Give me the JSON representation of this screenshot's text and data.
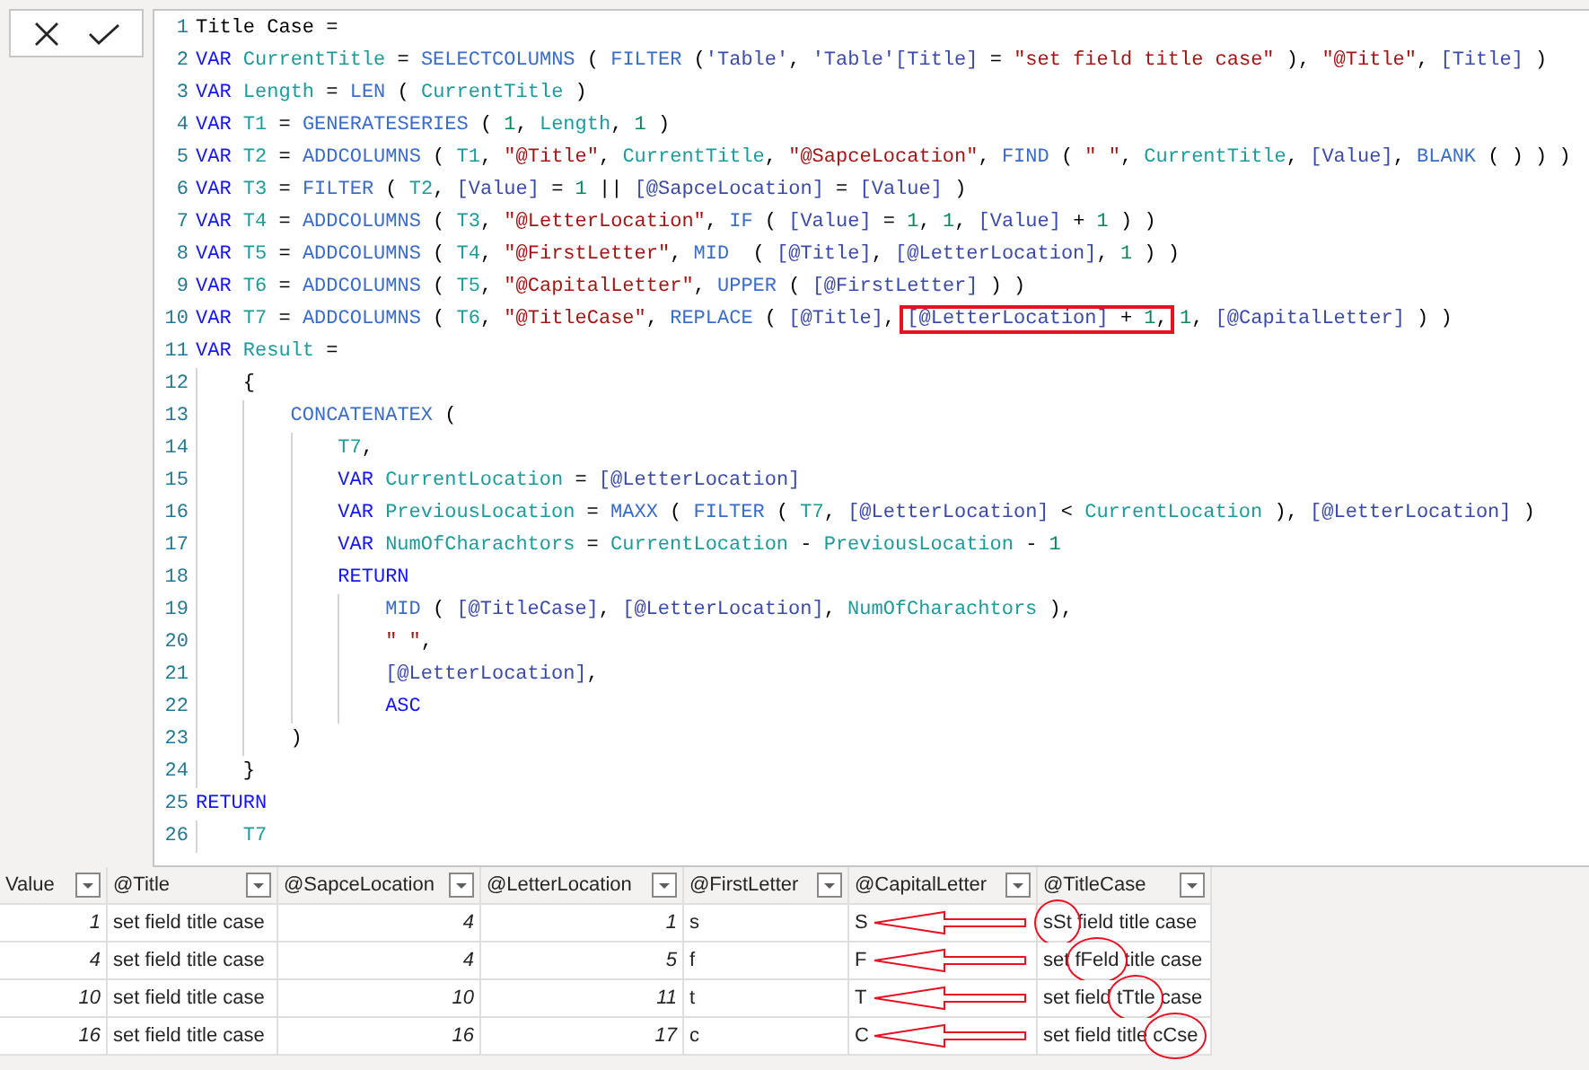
{
  "formula_bar": {
    "buttons": [
      {
        "kind": "cancel"
      },
      {
        "kind": "commit"
      }
    ]
  },
  "editor": {
    "lines": [
      {
        "number": "1",
        "tokens": [
          {
            "kind": "plain",
            "text": "Title Case ="
          }
        ]
      },
      {
        "number": "2",
        "tokens": [
          {
            "kind": "keyword",
            "text": "VAR"
          },
          {
            "kind": "variable",
            "text": " CurrentTitle"
          },
          {
            "kind": "plain",
            "text": " = "
          },
          {
            "kind": "function",
            "text": "SELECTCOLUMNS"
          },
          {
            "kind": "plain",
            "text": " ( "
          },
          {
            "kind": "function",
            "text": "FILTER"
          },
          {
            "kind": "plain",
            "text": " ("
          },
          {
            "kind": "column",
            "text": "'Table'"
          },
          {
            "kind": "plain",
            "text": ", "
          },
          {
            "kind": "column",
            "text": "'Table'[Title]"
          },
          {
            "kind": "plain",
            "text": " = "
          },
          {
            "kind": "string",
            "text": "\"set field title case\""
          },
          {
            "kind": "plain",
            "text": " ), "
          },
          {
            "kind": "string",
            "text": "\"@Title\""
          },
          {
            "kind": "plain",
            "text": ", "
          },
          {
            "kind": "column",
            "text": "[Title]"
          },
          {
            "kind": "plain",
            "text": " )"
          }
        ]
      },
      {
        "number": "3",
        "tokens": [
          {
            "kind": "keyword",
            "text": "VAR"
          },
          {
            "kind": "variable",
            "text": " Length"
          },
          {
            "kind": "plain",
            "text": " = "
          },
          {
            "kind": "function",
            "text": "LEN"
          },
          {
            "kind": "plain",
            "text": " ( "
          },
          {
            "kind": "variable",
            "text": "CurrentTitle"
          },
          {
            "kind": "plain",
            "text": " )"
          }
        ]
      },
      {
        "number": "4",
        "tokens": [
          {
            "kind": "keyword",
            "text": "VAR"
          },
          {
            "kind": "variable",
            "text": " T1"
          },
          {
            "kind": "plain",
            "text": " = "
          },
          {
            "kind": "function",
            "text": "GENERATESERIES"
          },
          {
            "kind": "plain",
            "text": " ( "
          },
          {
            "kind": "number",
            "text": "1"
          },
          {
            "kind": "plain",
            "text": ", "
          },
          {
            "kind": "variable",
            "text": "Length"
          },
          {
            "kind": "plain",
            "text": ", "
          },
          {
            "kind": "number",
            "text": "1"
          },
          {
            "kind": "plain",
            "text": " )"
          }
        ]
      },
      {
        "number": "5",
        "tokens": [
          {
            "kind": "keyword",
            "text": "VAR"
          },
          {
            "kind": "variable",
            "text": " T2"
          },
          {
            "kind": "plain",
            "text": " = "
          },
          {
            "kind": "function",
            "text": "ADDCOLUMNS"
          },
          {
            "kind": "plain",
            "text": " ( "
          },
          {
            "kind": "variable",
            "text": "T1"
          },
          {
            "kind": "plain",
            "text": ", "
          },
          {
            "kind": "string",
            "text": "\"@Title\""
          },
          {
            "kind": "plain",
            "text": ", "
          },
          {
            "kind": "variable",
            "text": "CurrentTitle"
          },
          {
            "kind": "plain",
            "text": ", "
          },
          {
            "kind": "string",
            "text": "\"@SapceLocation\""
          },
          {
            "kind": "plain",
            "text": ", "
          },
          {
            "kind": "function",
            "text": "FIND"
          },
          {
            "kind": "plain",
            "text": " ( "
          },
          {
            "kind": "string",
            "text": "\" \""
          },
          {
            "kind": "plain",
            "text": ", "
          },
          {
            "kind": "variable",
            "text": "CurrentTitle"
          },
          {
            "kind": "plain",
            "text": ", "
          },
          {
            "kind": "column",
            "text": "[Value]"
          },
          {
            "kind": "plain",
            "text": ", "
          },
          {
            "kind": "function",
            "text": "BLANK"
          },
          {
            "kind": "plain",
            "text": " ( ) ) )"
          }
        ]
      },
      {
        "number": "6",
        "tokens": [
          {
            "kind": "keyword",
            "text": "VAR"
          },
          {
            "kind": "variable",
            "text": " T3"
          },
          {
            "kind": "plain",
            "text": " = "
          },
          {
            "kind": "function",
            "text": "FILTER"
          },
          {
            "kind": "plain",
            "text": " ( "
          },
          {
            "kind": "variable",
            "text": "T2"
          },
          {
            "kind": "plain",
            "text": ", "
          },
          {
            "kind": "column",
            "text": "[Value]"
          },
          {
            "kind": "plain",
            "text": " = "
          },
          {
            "kind": "number",
            "text": "1"
          },
          {
            "kind": "plain",
            "text": " || "
          },
          {
            "kind": "column",
            "text": "[@SapceLocation]"
          },
          {
            "kind": "plain",
            "text": " = "
          },
          {
            "kind": "column",
            "text": "[Value]"
          },
          {
            "kind": "plain",
            "text": " )"
          }
        ]
      },
      {
        "number": "7",
        "tokens": [
          {
            "kind": "keyword",
            "text": "VAR"
          },
          {
            "kind": "variable",
            "text": " T4"
          },
          {
            "kind": "plain",
            "text": " = "
          },
          {
            "kind": "function",
            "text": "ADDCOLUMNS"
          },
          {
            "kind": "plain",
            "text": " ( "
          },
          {
            "kind": "variable",
            "text": "T3"
          },
          {
            "kind": "plain",
            "text": ", "
          },
          {
            "kind": "string",
            "text": "\"@LetterLocation\""
          },
          {
            "kind": "plain",
            "text": ", "
          },
          {
            "kind": "function",
            "text": "IF"
          },
          {
            "kind": "plain",
            "text": " ( "
          },
          {
            "kind": "column",
            "text": "[Value]"
          },
          {
            "kind": "plain",
            "text": " = "
          },
          {
            "kind": "number",
            "text": "1"
          },
          {
            "kind": "plain",
            "text": ", "
          },
          {
            "kind": "number",
            "text": "1"
          },
          {
            "kind": "plain",
            "text": ", "
          },
          {
            "kind": "column",
            "text": "[Value]"
          },
          {
            "kind": "plain",
            "text": " + "
          },
          {
            "kind": "number",
            "text": "1"
          },
          {
            "kind": "plain",
            "text": " ) )"
          }
        ]
      },
      {
        "number": "8",
        "tokens": [
          {
            "kind": "keyword",
            "text": "VAR"
          },
          {
            "kind": "variable",
            "text": " T5"
          },
          {
            "kind": "plain",
            "text": " = "
          },
          {
            "kind": "function",
            "text": "ADDCOLUMNS"
          },
          {
            "kind": "plain",
            "text": " ( "
          },
          {
            "kind": "variable",
            "text": "T4"
          },
          {
            "kind": "plain",
            "text": ", "
          },
          {
            "kind": "string",
            "text": "\"@FirstLetter\""
          },
          {
            "kind": "plain",
            "text": ", "
          },
          {
            "kind": "function",
            "text": "MID"
          },
          {
            "kind": "plain",
            "text": "  ( "
          },
          {
            "kind": "column",
            "text": "[@Title]"
          },
          {
            "kind": "plain",
            "text": ", "
          },
          {
            "kind": "column",
            "text": "[@LetterLocation]"
          },
          {
            "kind": "plain",
            "text": ", "
          },
          {
            "kind": "number",
            "text": "1"
          },
          {
            "kind": "plain",
            "text": " ) )"
          }
        ]
      },
      {
        "number": "9",
        "tokens": [
          {
            "kind": "keyword",
            "text": "VAR"
          },
          {
            "kind": "variable",
            "text": " T6"
          },
          {
            "kind": "plain",
            "text": " = "
          },
          {
            "kind": "function",
            "text": "ADDCOLUMNS"
          },
          {
            "kind": "plain",
            "text": " ( "
          },
          {
            "kind": "variable",
            "text": "T5"
          },
          {
            "kind": "plain",
            "text": ", "
          },
          {
            "kind": "string",
            "text": "\"@CapitalLetter\""
          },
          {
            "kind": "plain",
            "text": ", "
          },
          {
            "kind": "function",
            "text": "UPPER"
          },
          {
            "kind": "plain",
            "text": " ( "
          },
          {
            "kind": "column",
            "text": "[@FirstLetter]"
          },
          {
            "kind": "plain",
            "text": " ) )"
          }
        ]
      },
      {
        "number": "10",
        "tokens": [
          {
            "kind": "keyword",
            "text": "VAR"
          },
          {
            "kind": "variable",
            "text": " T7"
          },
          {
            "kind": "plain",
            "text": " = "
          },
          {
            "kind": "function",
            "text": "ADDCOLUMNS"
          },
          {
            "kind": "plain",
            "text": " ( "
          },
          {
            "kind": "variable",
            "text": "T6"
          },
          {
            "kind": "plain",
            "text": ", "
          },
          {
            "kind": "string",
            "text": "\"@TitleCase\""
          },
          {
            "kind": "plain",
            "text": ", "
          },
          {
            "kind": "function",
            "text": "REPLACE"
          },
          {
            "kind": "plain",
            "text": " ( "
          },
          {
            "kind": "column",
            "text": "[@Title]"
          },
          {
            "kind": "plain",
            "text": ", "
          },
          {
            "kind": "column",
            "text": "[@LetterLocation]",
            "boxed": true
          },
          {
            "kind": "plain",
            "text": " + ",
            "boxed": true
          },
          {
            "kind": "number",
            "text": "1",
            "boxed": true
          },
          {
            "kind": "plain",
            "text": ",",
            "boxed": true
          },
          {
            "kind": "number",
            "text": " 1"
          },
          {
            "kind": "plain",
            "text": ", "
          },
          {
            "kind": "column",
            "text": "[@CapitalLetter]"
          },
          {
            "kind": "plain",
            "text": " ) )"
          }
        ]
      },
      {
        "number": "11",
        "tokens": [
          {
            "kind": "keyword",
            "text": "VAR"
          },
          {
            "kind": "variable",
            "text": " Result"
          },
          {
            "kind": "plain",
            "text": " ="
          }
        ],
        "children": [
          {
            "number": "12",
            "tokens": [
              {
                "kind": "plain",
                "text": "{"
              }
            ],
            "children": [
              {
                "number": "13",
                "tokens": [
                  {
                    "kind": "function",
                    "text": "CONCATENATEX"
                  },
                  {
                    "kind": "plain",
                    "text": " ("
                  }
                ],
                "children": [
                  {
                    "number": "14",
                    "tokens": [
                      {
                        "kind": "variable",
                        "text": "T7"
                      },
                      {
                        "kind": "plain",
                        "text": ","
                      }
                    ]
                  },
                  {
                    "number": "15",
                    "tokens": [
                      {
                        "kind": "keyword",
                        "text": "VAR"
                      },
                      {
                        "kind": "variable",
                        "text": " CurrentLocation"
                      },
                      {
                        "kind": "plain",
                        "text": " = "
                      },
                      {
                        "kind": "column",
                        "text": "[@LetterLocation]"
                      }
                    ]
                  },
                  {
                    "number": "16",
                    "tokens": [
                      {
                        "kind": "keyword",
                        "text": "VAR"
                      },
                      {
                        "kind": "variable",
                        "text": " PreviousLocation"
                      },
                      {
                        "kind": "plain",
                        "text": " = "
                      },
                      {
                        "kind": "function",
                        "text": "MAXX"
                      },
                      {
                        "kind": "plain",
                        "text": " ( "
                      },
                      {
                        "kind": "function",
                        "text": "FILTER"
                      },
                      {
                        "kind": "plain",
                        "text": " ( "
                      },
                      {
                        "kind": "variable",
                        "text": "T7"
                      },
                      {
                        "kind": "plain",
                        "text": ", "
                      },
                      {
                        "kind": "column",
                        "text": "[@LetterLocation]"
                      },
                      {
                        "kind": "plain",
                        "text": " < "
                      },
                      {
                        "kind": "variable",
                        "text": "CurrentLocation"
                      },
                      {
                        "kind": "plain",
                        "text": " ), "
                      },
                      {
                        "kind": "column",
                        "text": "[@LetterLocation]"
                      },
                      {
                        "kind": "plain",
                        "text": " )"
                      }
                    ]
                  },
                  {
                    "number": "17",
                    "tokens": [
                      {
                        "kind": "keyword",
                        "text": "VAR"
                      },
                      {
                        "kind": "variable",
                        "text": " NumOfCharachtors"
                      },
                      {
                        "kind": "plain",
                        "text": " = "
                      },
                      {
                        "kind": "variable",
                        "text": "CurrentLocation"
                      },
                      {
                        "kind": "plain",
                        "text": " - "
                      },
                      {
                        "kind": "variable",
                        "text": "PreviousLocation"
                      },
                      {
                        "kind": "plain",
                        "text": " - "
                      },
                      {
                        "kind": "number",
                        "text": "1"
                      }
                    ]
                  },
                  {
                    "number": "18",
                    "tokens": [
                      {
                        "kind": "keyword",
                        "text": "RETURN"
                      }
                    ],
                    "children": [
                      {
                        "number": "19",
                        "tokens": [
                          {
                            "kind": "function",
                            "text": "MID"
                          },
                          {
                            "kind": "plain",
                            "text": " ( "
                          },
                          {
                            "kind": "column",
                            "text": "[@TitleCase]"
                          },
                          {
                            "kind": "plain",
                            "text": ", "
                          },
                          {
                            "kind": "column",
                            "text": "[@LetterLocation]"
                          },
                          {
                            "kind": "plain",
                            "text": ", "
                          },
                          {
                            "kind": "variable",
                            "text": "NumOfCharachtors"
                          },
                          {
                            "kind": "plain",
                            "text": " ),"
                          }
                        ]
                      },
                      {
                        "number": "20",
                        "tokens": [
                          {
                            "kind": "string",
                            "text": "\" \""
                          },
                          {
                            "kind": "plain",
                            "text": ","
                          }
                        ]
                      },
                      {
                        "number": "21",
                        "tokens": [
                          {
                            "kind": "column",
                            "text": "[@LetterLocation]"
                          },
                          {
                            "kind": "plain",
                            "text": ","
                          }
                        ]
                      },
                      {
                        "number": "22",
                        "tokens": [
                          {
                            "kind": "keyword",
                            "text": "ASC"
                          }
                        ]
                      }
                    ]
                  }
                ]
              },
              {
                "number": "23",
                "tokens": [
                  {
                    "kind": "plain",
                    "text": ")"
                  }
                ]
              }
            ]
          },
          {
            "number": "24",
            "tokens": [
              {
                "kind": "plain",
                "text": "}"
              }
            ]
          }
        ]
      },
      {
        "number": "25",
        "tokens": [
          {
            "kind": "keyword",
            "text": "RETURN"
          }
        ],
        "children": [
          {
            "number": "26",
            "tokens": [
              {
                "kind": "variable",
                "text": "T7"
              }
            ]
          }
        ]
      }
    ]
  },
  "table": {
    "columns": [
      {
        "label": "Value",
        "kind": "number"
      },
      {
        "label": "@Title",
        "kind": "text"
      },
      {
        "label": "@SapceLocation",
        "kind": "number"
      },
      {
        "label": "@LetterLocation",
        "kind": "number"
      },
      {
        "label": "@FirstLetter",
        "kind": "text"
      },
      {
        "label": "@CapitalLetter",
        "kind": "text"
      },
      {
        "label": "@TitleCase",
        "kind": "text"
      }
    ],
    "rows": [
      {
        "cells": [
          "1",
          "set field title case",
          "4",
          "1",
          "s",
          "S",
          "sSt field title case"
        ],
        "annotated": true
      },
      {
        "cells": [
          "4",
          "set field title case",
          "4",
          "5",
          "f",
          "F",
          "set fFeld title case"
        ],
        "annotated": true
      },
      {
        "cells": [
          "10",
          "set field title case",
          "10",
          "11",
          "t",
          "T",
          "set field tTtle case"
        ],
        "annotated": true
      },
      {
        "cells": [
          "16",
          "set field title case",
          "16",
          "17",
          "c",
          "C",
          "set field title cCse"
        ],
        "annotated": true
      }
    ]
  }
}
